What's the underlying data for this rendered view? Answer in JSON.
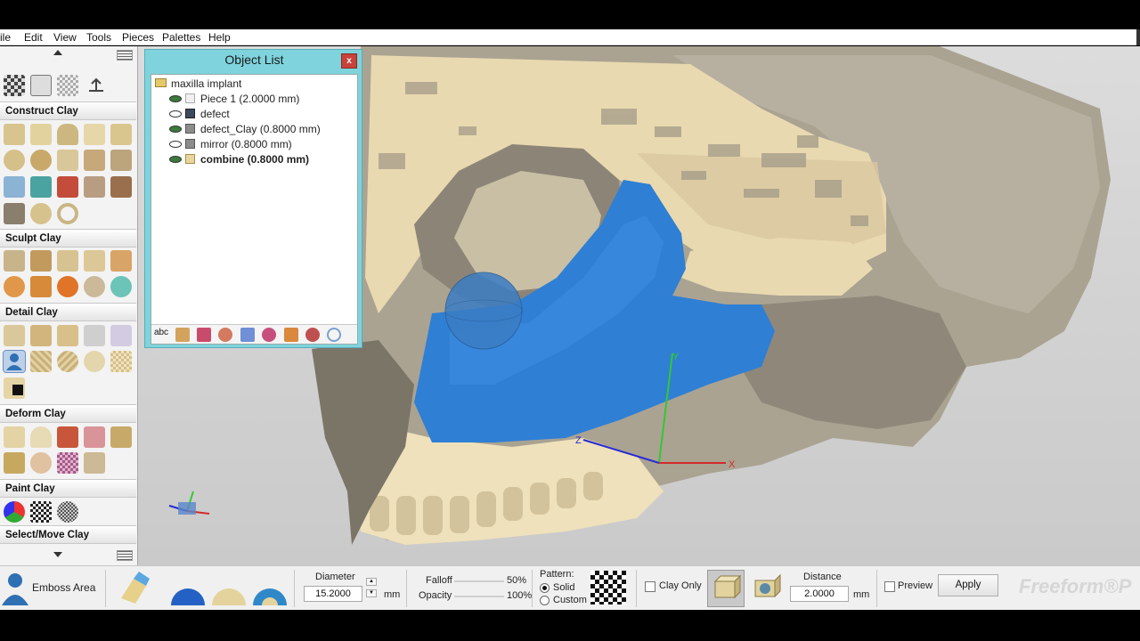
{
  "menu": [
    "ile",
    "Edit",
    "View",
    "Tools",
    "Pieces",
    "Palettes",
    "Help"
  ],
  "palette": {
    "sections": [
      "Construct Clay",
      "Sculpt Clay",
      "Detail Clay",
      "Deform Clay",
      "Paint Clay",
      "Select/Move Clay"
    ]
  },
  "object_list": {
    "title": "Object List",
    "close": "x",
    "root": "maxilla implant",
    "items": [
      {
        "label": "Piece 1 (2.0000 mm)"
      },
      {
        "label": "defect"
      },
      {
        "label": "defect_Clay (0.8000 mm)"
      },
      {
        "label": "mirror (0.8000 mm)"
      },
      {
        "label": "combine (0.8000 mm)"
      }
    ],
    "toolbar_abc": "abc"
  },
  "axes": {
    "x": "X",
    "y": "Y",
    "z": "Z"
  },
  "bottom": {
    "tool_name": "Emboss Area",
    "diameter_label": "Diameter",
    "diameter_value": "15.2000",
    "diameter_unit": "mm",
    "falloff_label": "Falloff",
    "falloff_pct": "50%",
    "opacity_label": "Opacity",
    "opacity_pct": "100%",
    "pattern_label": "Pattern:",
    "pattern_solid": "Solid",
    "pattern_custom": "Custom",
    "clay_only": "Clay Only",
    "distance_label": "Distance",
    "distance_value": "2.0000",
    "distance_unit": "mm",
    "preview": "Preview",
    "apply": "Apply",
    "brand": "Freeform®P"
  },
  "colors": {
    "bone": "#efe1bb",
    "bone_gray": "#a59e8e",
    "clay_blue": "#2e7fd3",
    "accent_teal": "#7ed3dc"
  }
}
